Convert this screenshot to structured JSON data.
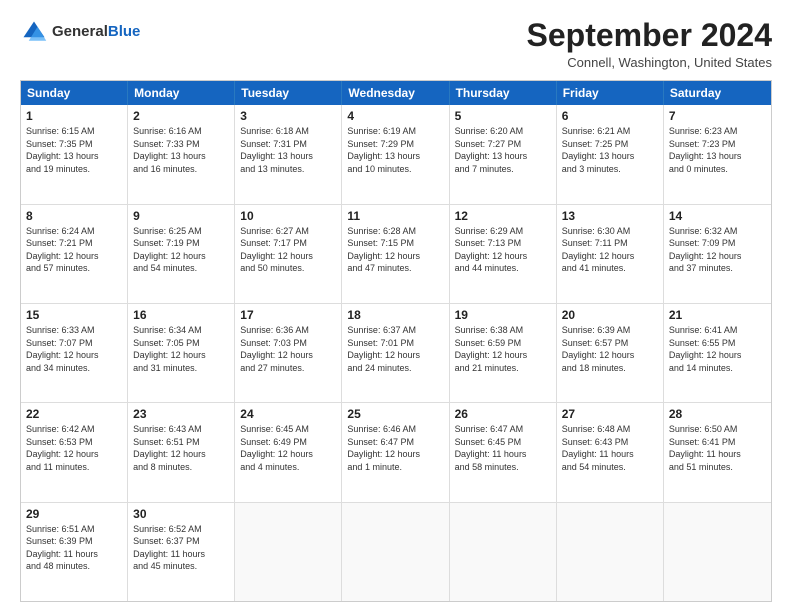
{
  "header": {
    "logo": {
      "general": "General",
      "blue": "Blue"
    },
    "title": "September 2024",
    "location": "Connell, Washington, United States"
  },
  "weekdays": [
    "Sunday",
    "Monday",
    "Tuesday",
    "Wednesday",
    "Thursday",
    "Friday",
    "Saturday"
  ],
  "rows": [
    [
      {
        "day": "1",
        "lines": [
          "Sunrise: 6:15 AM",
          "Sunset: 7:35 PM",
          "Daylight: 13 hours",
          "and 19 minutes."
        ]
      },
      {
        "day": "2",
        "lines": [
          "Sunrise: 6:16 AM",
          "Sunset: 7:33 PM",
          "Daylight: 13 hours",
          "and 16 minutes."
        ]
      },
      {
        "day": "3",
        "lines": [
          "Sunrise: 6:18 AM",
          "Sunset: 7:31 PM",
          "Daylight: 13 hours",
          "and 13 minutes."
        ]
      },
      {
        "day": "4",
        "lines": [
          "Sunrise: 6:19 AM",
          "Sunset: 7:29 PM",
          "Daylight: 13 hours",
          "and 10 minutes."
        ]
      },
      {
        "day": "5",
        "lines": [
          "Sunrise: 6:20 AM",
          "Sunset: 7:27 PM",
          "Daylight: 13 hours",
          "and 7 minutes."
        ]
      },
      {
        "day": "6",
        "lines": [
          "Sunrise: 6:21 AM",
          "Sunset: 7:25 PM",
          "Daylight: 13 hours",
          "and 3 minutes."
        ]
      },
      {
        "day": "7",
        "lines": [
          "Sunrise: 6:23 AM",
          "Sunset: 7:23 PM",
          "Daylight: 13 hours",
          "and 0 minutes."
        ]
      }
    ],
    [
      {
        "day": "8",
        "lines": [
          "Sunrise: 6:24 AM",
          "Sunset: 7:21 PM",
          "Daylight: 12 hours",
          "and 57 minutes."
        ]
      },
      {
        "day": "9",
        "lines": [
          "Sunrise: 6:25 AM",
          "Sunset: 7:19 PM",
          "Daylight: 12 hours",
          "and 54 minutes."
        ]
      },
      {
        "day": "10",
        "lines": [
          "Sunrise: 6:27 AM",
          "Sunset: 7:17 PM",
          "Daylight: 12 hours",
          "and 50 minutes."
        ]
      },
      {
        "day": "11",
        "lines": [
          "Sunrise: 6:28 AM",
          "Sunset: 7:15 PM",
          "Daylight: 12 hours",
          "and 47 minutes."
        ]
      },
      {
        "day": "12",
        "lines": [
          "Sunrise: 6:29 AM",
          "Sunset: 7:13 PM",
          "Daylight: 12 hours",
          "and 44 minutes."
        ]
      },
      {
        "day": "13",
        "lines": [
          "Sunrise: 6:30 AM",
          "Sunset: 7:11 PM",
          "Daylight: 12 hours",
          "and 41 minutes."
        ]
      },
      {
        "day": "14",
        "lines": [
          "Sunrise: 6:32 AM",
          "Sunset: 7:09 PM",
          "Daylight: 12 hours",
          "and 37 minutes."
        ]
      }
    ],
    [
      {
        "day": "15",
        "lines": [
          "Sunrise: 6:33 AM",
          "Sunset: 7:07 PM",
          "Daylight: 12 hours",
          "and 34 minutes."
        ]
      },
      {
        "day": "16",
        "lines": [
          "Sunrise: 6:34 AM",
          "Sunset: 7:05 PM",
          "Daylight: 12 hours",
          "and 31 minutes."
        ]
      },
      {
        "day": "17",
        "lines": [
          "Sunrise: 6:36 AM",
          "Sunset: 7:03 PM",
          "Daylight: 12 hours",
          "and 27 minutes."
        ]
      },
      {
        "day": "18",
        "lines": [
          "Sunrise: 6:37 AM",
          "Sunset: 7:01 PM",
          "Daylight: 12 hours",
          "and 24 minutes."
        ]
      },
      {
        "day": "19",
        "lines": [
          "Sunrise: 6:38 AM",
          "Sunset: 6:59 PM",
          "Daylight: 12 hours",
          "and 21 minutes."
        ]
      },
      {
        "day": "20",
        "lines": [
          "Sunrise: 6:39 AM",
          "Sunset: 6:57 PM",
          "Daylight: 12 hours",
          "and 18 minutes."
        ]
      },
      {
        "day": "21",
        "lines": [
          "Sunrise: 6:41 AM",
          "Sunset: 6:55 PM",
          "Daylight: 12 hours",
          "and 14 minutes."
        ]
      }
    ],
    [
      {
        "day": "22",
        "lines": [
          "Sunrise: 6:42 AM",
          "Sunset: 6:53 PM",
          "Daylight: 12 hours",
          "and 11 minutes."
        ]
      },
      {
        "day": "23",
        "lines": [
          "Sunrise: 6:43 AM",
          "Sunset: 6:51 PM",
          "Daylight: 12 hours",
          "and 8 minutes."
        ]
      },
      {
        "day": "24",
        "lines": [
          "Sunrise: 6:45 AM",
          "Sunset: 6:49 PM",
          "Daylight: 12 hours",
          "and 4 minutes."
        ]
      },
      {
        "day": "25",
        "lines": [
          "Sunrise: 6:46 AM",
          "Sunset: 6:47 PM",
          "Daylight: 12 hours",
          "and 1 minute."
        ]
      },
      {
        "day": "26",
        "lines": [
          "Sunrise: 6:47 AM",
          "Sunset: 6:45 PM",
          "Daylight: 11 hours",
          "and 58 minutes."
        ]
      },
      {
        "day": "27",
        "lines": [
          "Sunrise: 6:48 AM",
          "Sunset: 6:43 PM",
          "Daylight: 11 hours",
          "and 54 minutes."
        ]
      },
      {
        "day": "28",
        "lines": [
          "Sunrise: 6:50 AM",
          "Sunset: 6:41 PM",
          "Daylight: 11 hours",
          "and 51 minutes."
        ]
      }
    ],
    [
      {
        "day": "29",
        "lines": [
          "Sunrise: 6:51 AM",
          "Sunset: 6:39 PM",
          "Daylight: 11 hours",
          "and 48 minutes."
        ]
      },
      {
        "day": "30",
        "lines": [
          "Sunrise: 6:52 AM",
          "Sunset: 6:37 PM",
          "Daylight: 11 hours",
          "and 45 minutes."
        ]
      },
      {
        "day": "",
        "lines": []
      },
      {
        "day": "",
        "lines": []
      },
      {
        "day": "",
        "lines": []
      },
      {
        "day": "",
        "lines": []
      },
      {
        "day": "",
        "lines": []
      }
    ]
  ]
}
